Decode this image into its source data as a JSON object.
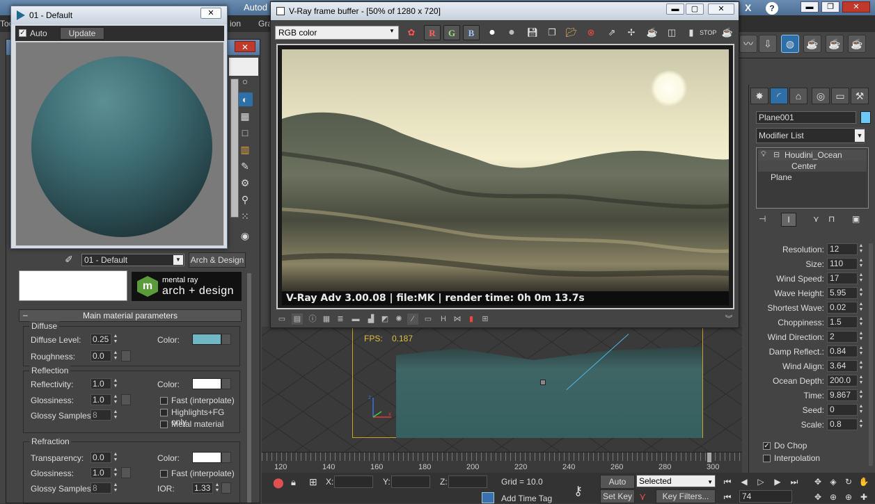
{
  "main_app": {
    "title_fragment": "Autod",
    "menu_fragment_1": "ion",
    "menu_fragment_2": "Gra",
    "menu_fragment_3": "Toc",
    "search_placeholder": ""
  },
  "preview_window": {
    "title": "01 - Default",
    "close_label": "✕",
    "auto_label": "Auto",
    "auto_checked": true,
    "update_label": "Update"
  },
  "material_editor": {
    "close_label": "✕",
    "material_name": "01 - Default",
    "material_type": "Arch & Design",
    "logo_small": "mental ray",
    "logo_big": "arch + design",
    "logo_mark": "m",
    "rollout_title": "Main material parameters",
    "rollout_toggle": "–",
    "diffuse": {
      "title": "Diffuse",
      "level_label": "Diffuse Level:",
      "level_value": "0.25",
      "roughness_label": "Roughness:",
      "roughness_value": "0.0",
      "color_label": "Color:",
      "color_hex": "#6fb8c3"
    },
    "reflection": {
      "title": "Reflection",
      "reflectivity_label": "Reflectivity:",
      "reflectivity_value": "1.0",
      "glossiness_label": "Glossiness:",
      "glossiness_value": "1.0",
      "glossy_samples_label": "Glossy Samples:",
      "glossy_samples_value": "8",
      "color_label": "Color:",
      "color_hex": "#ffffff",
      "fast_label": "Fast (interpolate)",
      "highlights_label": "Highlights+FG only",
      "metal_label": "Metal material"
    },
    "refraction": {
      "title": "Refraction",
      "transparency_label": "Transparency:",
      "transparency_value": "0.0",
      "glossiness_label": "Glossiness:",
      "glossiness_value": "1.0",
      "glossy_samples_label": "Glossy Samples:",
      "glossy_samples_value": "8",
      "color_label": "Color:",
      "color_hex": "#ffffff",
      "fast_label": "Fast (interpolate)",
      "ior_label": "IOR:",
      "ior_value": "1.33"
    }
  },
  "vfb": {
    "title": "V-Ray frame buffer - [50% of 1280 x 720]",
    "channel": "RGB color",
    "btn_r": "R",
    "btn_g": "G",
    "btn_b": "B",
    "caption": "V-Ray Adv 3.00.08 | file:MK | render time:  0h  0m 13.7s",
    "win_min": "▬",
    "win_max": "▢",
    "win_close": "✕"
  },
  "viewport": {
    "fps_label": "FPS:",
    "fps_value": "0.187",
    "axis_z": "z",
    "axis_x": "x"
  },
  "timeline": {
    "ticks": [
      "120",
      "140",
      "160",
      "180",
      "200",
      "220",
      "240",
      "260",
      "280",
      "300"
    ]
  },
  "status_bar": {
    "x_label": "X:",
    "y_label": "Y:",
    "z_label": "Z:",
    "grid_label": "Grid = 10.0",
    "add_time_tag": "Add Time Tag",
    "auto_key": "Auto Key",
    "set_key": "Set Key",
    "selected_option": "Selected",
    "key_filters": "Key Filters...",
    "frame_value": "74"
  },
  "command_panel": {
    "object_name": "Plane001",
    "object_color": "#6cc9f7",
    "modifier_list": "Modifier List",
    "stack": {
      "houdini_ocean": "Houdini_Ocean",
      "center": "Center",
      "plane": "Plane"
    },
    "params": [
      {
        "label": "Resolution:",
        "value": "12"
      },
      {
        "label": "Size:",
        "value": "110"
      },
      {
        "label": "Wind Speed:",
        "value": "17"
      },
      {
        "label": "Wave Height:",
        "value": "5.95"
      },
      {
        "label": "Shortest Wave:",
        "value": "0.02"
      },
      {
        "label": "Choppiness:",
        "value": "1.5"
      },
      {
        "label": "Wind Direction:",
        "value": "2"
      },
      {
        "label": "Damp Reflect.:",
        "value": "0.84"
      },
      {
        "label": "Wind Align:",
        "value": "3.64"
      },
      {
        "label": "Ocean Depth:",
        "value": "200.0"
      },
      {
        "label": "Time:",
        "value": "9.867"
      },
      {
        "label": "Seed:",
        "value": "0"
      },
      {
        "label": "Scale:",
        "value": "0.8"
      }
    ],
    "do_chop_label": "Do Chop",
    "do_chop_checked": true,
    "interpolation_label": "Interpolation",
    "interpolation_checked": false
  }
}
